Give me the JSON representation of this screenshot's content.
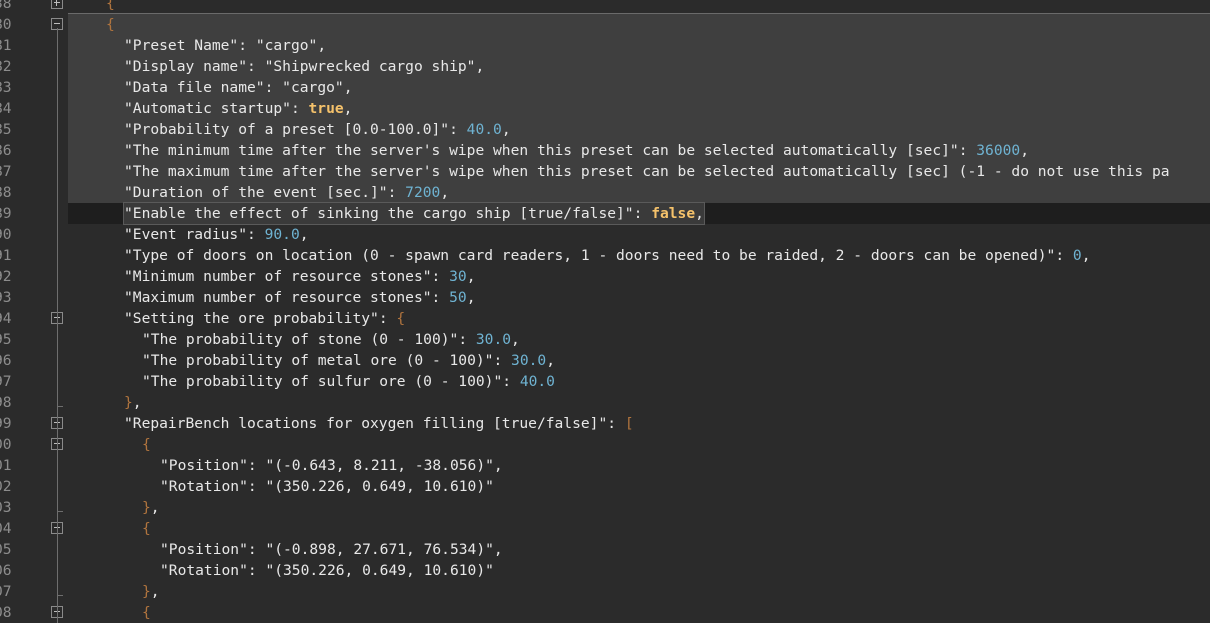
{
  "lines": [
    {
      "num": "38",
      "indent": 0,
      "parts": [
        {
          "t": "{",
          "c": "brace"
        }
      ],
      "fold": "plus"
    },
    {
      "num": "80",
      "indent": 0,
      "parts": [
        {
          "t": "{",
          "c": "brace"
        }
      ],
      "fold": "minus"
    },
    {
      "num": "81",
      "indent": 1,
      "parts": [
        {
          "t": "\"Preset Name\"",
          "c": "k"
        },
        {
          "t": ": ",
          "c": "k"
        },
        {
          "t": "\"cargo\"",
          "c": "k"
        },
        {
          "t": ",",
          "c": "k"
        }
      ]
    },
    {
      "num": "82",
      "indent": 1,
      "parts": [
        {
          "t": "\"Display name\"",
          "c": "k"
        },
        {
          "t": ": ",
          "c": "k"
        },
        {
          "t": "\"Shipwrecked cargo ship\"",
          "c": "k"
        },
        {
          "t": ",",
          "c": "k"
        }
      ]
    },
    {
      "num": "83",
      "indent": 1,
      "parts": [
        {
          "t": "\"Data file name\"",
          "c": "k"
        },
        {
          "t": ": ",
          "c": "k"
        },
        {
          "t": "\"cargo\"",
          "c": "k"
        },
        {
          "t": ",",
          "c": "k"
        }
      ]
    },
    {
      "num": "84",
      "indent": 1,
      "parts": [
        {
          "t": "\"Automatic startup\"",
          "c": "k"
        },
        {
          "t": ": ",
          "c": "k"
        },
        {
          "t": "true",
          "c": "b"
        },
        {
          "t": ",",
          "c": "k"
        }
      ]
    },
    {
      "num": "85",
      "indent": 1,
      "parts": [
        {
          "t": "\"Probability of a preset [0.0-100.0]\"",
          "c": "k"
        },
        {
          "t": ": ",
          "c": "k"
        },
        {
          "t": "40.0",
          "c": "n"
        },
        {
          "t": ",",
          "c": "k"
        }
      ]
    },
    {
      "num": "86",
      "indent": 1,
      "parts": [
        {
          "t": "\"The minimum time after the server's wipe when this preset can be selected automatically [sec]\"",
          "c": "k"
        },
        {
          "t": ": ",
          "c": "k"
        },
        {
          "t": "36000",
          "c": "n"
        },
        {
          "t": ",",
          "c": "k"
        }
      ]
    },
    {
      "num": "87",
      "indent": 1,
      "parts": [
        {
          "t": "\"The maximum time after the server's wipe when this preset can be selected automatically [sec] (-1 - do not use this pa",
          "c": "k"
        }
      ]
    },
    {
      "num": "88",
      "indent": 1,
      "parts": [
        {
          "t": "\"Duration of the event [sec.]\"",
          "c": "k"
        },
        {
          "t": ": ",
          "c": "k"
        },
        {
          "t": "7200",
          "c": "n"
        },
        {
          "t": ",",
          "c": "k"
        }
      ]
    },
    {
      "num": "89",
      "indent": 1,
      "current": true,
      "parts": [
        {
          "t": "\"Enable the effect of sinking the cargo ship [true/false]\"",
          "c": "k"
        },
        {
          "t": ": ",
          "c": "k"
        },
        {
          "t": "false",
          "c": "b"
        },
        {
          "t": ",",
          "c": "k"
        }
      ]
    },
    {
      "num": "90",
      "indent": 1,
      "parts": [
        {
          "t": "\"Event radius\"",
          "c": "k"
        },
        {
          "t": ": ",
          "c": "k"
        },
        {
          "t": "90.0",
          "c": "n"
        },
        {
          "t": ",",
          "c": "k"
        }
      ]
    },
    {
      "num": "91",
      "indent": 1,
      "parts": [
        {
          "t": "\"Type of doors on location (0 - spawn card readers, 1 - doors need to be raided, 2 - doors can be opened)\"",
          "c": "k"
        },
        {
          "t": ": ",
          "c": "k"
        },
        {
          "t": "0",
          "c": "n"
        },
        {
          "t": ",",
          "c": "k"
        }
      ]
    },
    {
      "num": "92",
      "indent": 1,
      "parts": [
        {
          "t": "\"Minimum number of resource stones\"",
          "c": "k"
        },
        {
          "t": ": ",
          "c": "k"
        },
        {
          "t": "30",
          "c": "n"
        },
        {
          "t": ",",
          "c": "k"
        }
      ]
    },
    {
      "num": "93",
      "indent": 1,
      "parts": [
        {
          "t": "\"Maximum number of resource stones\"",
          "c": "k"
        },
        {
          "t": ": ",
          "c": "k"
        },
        {
          "t": "50",
          "c": "n"
        },
        {
          "t": ",",
          "c": "k"
        }
      ]
    },
    {
      "num": "94",
      "indent": 1,
      "fold": "minus",
      "parts": [
        {
          "t": "\"Setting the ore probability\"",
          "c": "k"
        },
        {
          "t": ": ",
          "c": "k"
        },
        {
          "t": "{",
          "c": "brace"
        }
      ]
    },
    {
      "num": "95",
      "indent": 2,
      "parts": [
        {
          "t": "\"The probability of stone (0 - 100)\"",
          "c": "k"
        },
        {
          "t": ": ",
          "c": "k"
        },
        {
          "t": "30.0",
          "c": "n"
        },
        {
          "t": ",",
          "c": "k"
        }
      ]
    },
    {
      "num": "96",
      "indent": 2,
      "parts": [
        {
          "t": "\"The probability of metal ore (0 - 100)\"",
          "c": "k"
        },
        {
          "t": ": ",
          "c": "k"
        },
        {
          "t": "30.0",
          "c": "n"
        },
        {
          "t": ",",
          "c": "k"
        }
      ]
    },
    {
      "num": "97",
      "indent": 2,
      "parts": [
        {
          "t": "\"The probability of sulfur ore (0 - 100)\"",
          "c": "k"
        },
        {
          "t": ": ",
          "c": "k"
        },
        {
          "t": "40.0",
          "c": "n"
        }
      ]
    },
    {
      "num": "98",
      "indent": 1,
      "fold": "end",
      "parts": [
        {
          "t": "}",
          "c": "brace"
        },
        {
          "t": ",",
          "c": "k"
        }
      ]
    },
    {
      "num": "99",
      "indent": 1,
      "fold": "minus",
      "parts": [
        {
          "t": "\"RepairBench locations for oxygen filling [true/false]\"",
          "c": "k"
        },
        {
          "t": ": ",
          "c": "k"
        },
        {
          "t": "[",
          "c": "brace"
        }
      ]
    },
    {
      "num": "00",
      "indent": 2,
      "fold": "minus",
      "parts": [
        {
          "t": "{",
          "c": "brace"
        }
      ]
    },
    {
      "num": "01",
      "indent": 3,
      "parts": [
        {
          "t": "\"Position\"",
          "c": "k"
        },
        {
          "t": ": ",
          "c": "k"
        },
        {
          "t": "\"(-0.643, 8.211, -38.056)\"",
          "c": "k"
        },
        {
          "t": ",",
          "c": "k"
        }
      ]
    },
    {
      "num": "02",
      "indent": 3,
      "parts": [
        {
          "t": "\"Rotation\"",
          "c": "k"
        },
        {
          "t": ": ",
          "c": "k"
        },
        {
          "t": "\"(350.226, 0.649, 10.610)\"",
          "c": "k"
        }
      ]
    },
    {
      "num": "03",
      "indent": 2,
      "fold": "end",
      "parts": [
        {
          "t": "}",
          "c": "brace"
        },
        {
          "t": ",",
          "c": "k"
        }
      ]
    },
    {
      "num": "04",
      "indent": 2,
      "fold": "minus",
      "parts": [
        {
          "t": "{",
          "c": "brace"
        }
      ]
    },
    {
      "num": "05",
      "indent": 3,
      "parts": [
        {
          "t": "\"Position\"",
          "c": "k"
        },
        {
          "t": ": ",
          "c": "k"
        },
        {
          "t": "\"(-0.898, 27.671, 76.534)\"",
          "c": "k"
        },
        {
          "t": ",",
          "c": "k"
        }
      ]
    },
    {
      "num": "06",
      "indent": 3,
      "parts": [
        {
          "t": "\"Rotation\"",
          "c": "k"
        },
        {
          "t": ": ",
          "c": "k"
        },
        {
          "t": "\"(350.226, 0.649, 10.610)\"",
          "c": "k"
        }
      ]
    },
    {
      "num": "07",
      "indent": 2,
      "fold": "end",
      "parts": [
        {
          "t": "}",
          "c": "brace"
        },
        {
          "t": ",",
          "c": "k"
        }
      ]
    },
    {
      "num": "08",
      "indent": 2,
      "fold": "minus",
      "parts": [
        {
          "t": "{",
          "c": "brace"
        }
      ]
    }
  ],
  "colors": {
    "background": "#2b2b2b",
    "selection": "#3f3f3f",
    "current_line": "#1e1e1e",
    "number": "#6fb3d2",
    "boolean": "#f5c26b",
    "brace": "#b0743e"
  }
}
